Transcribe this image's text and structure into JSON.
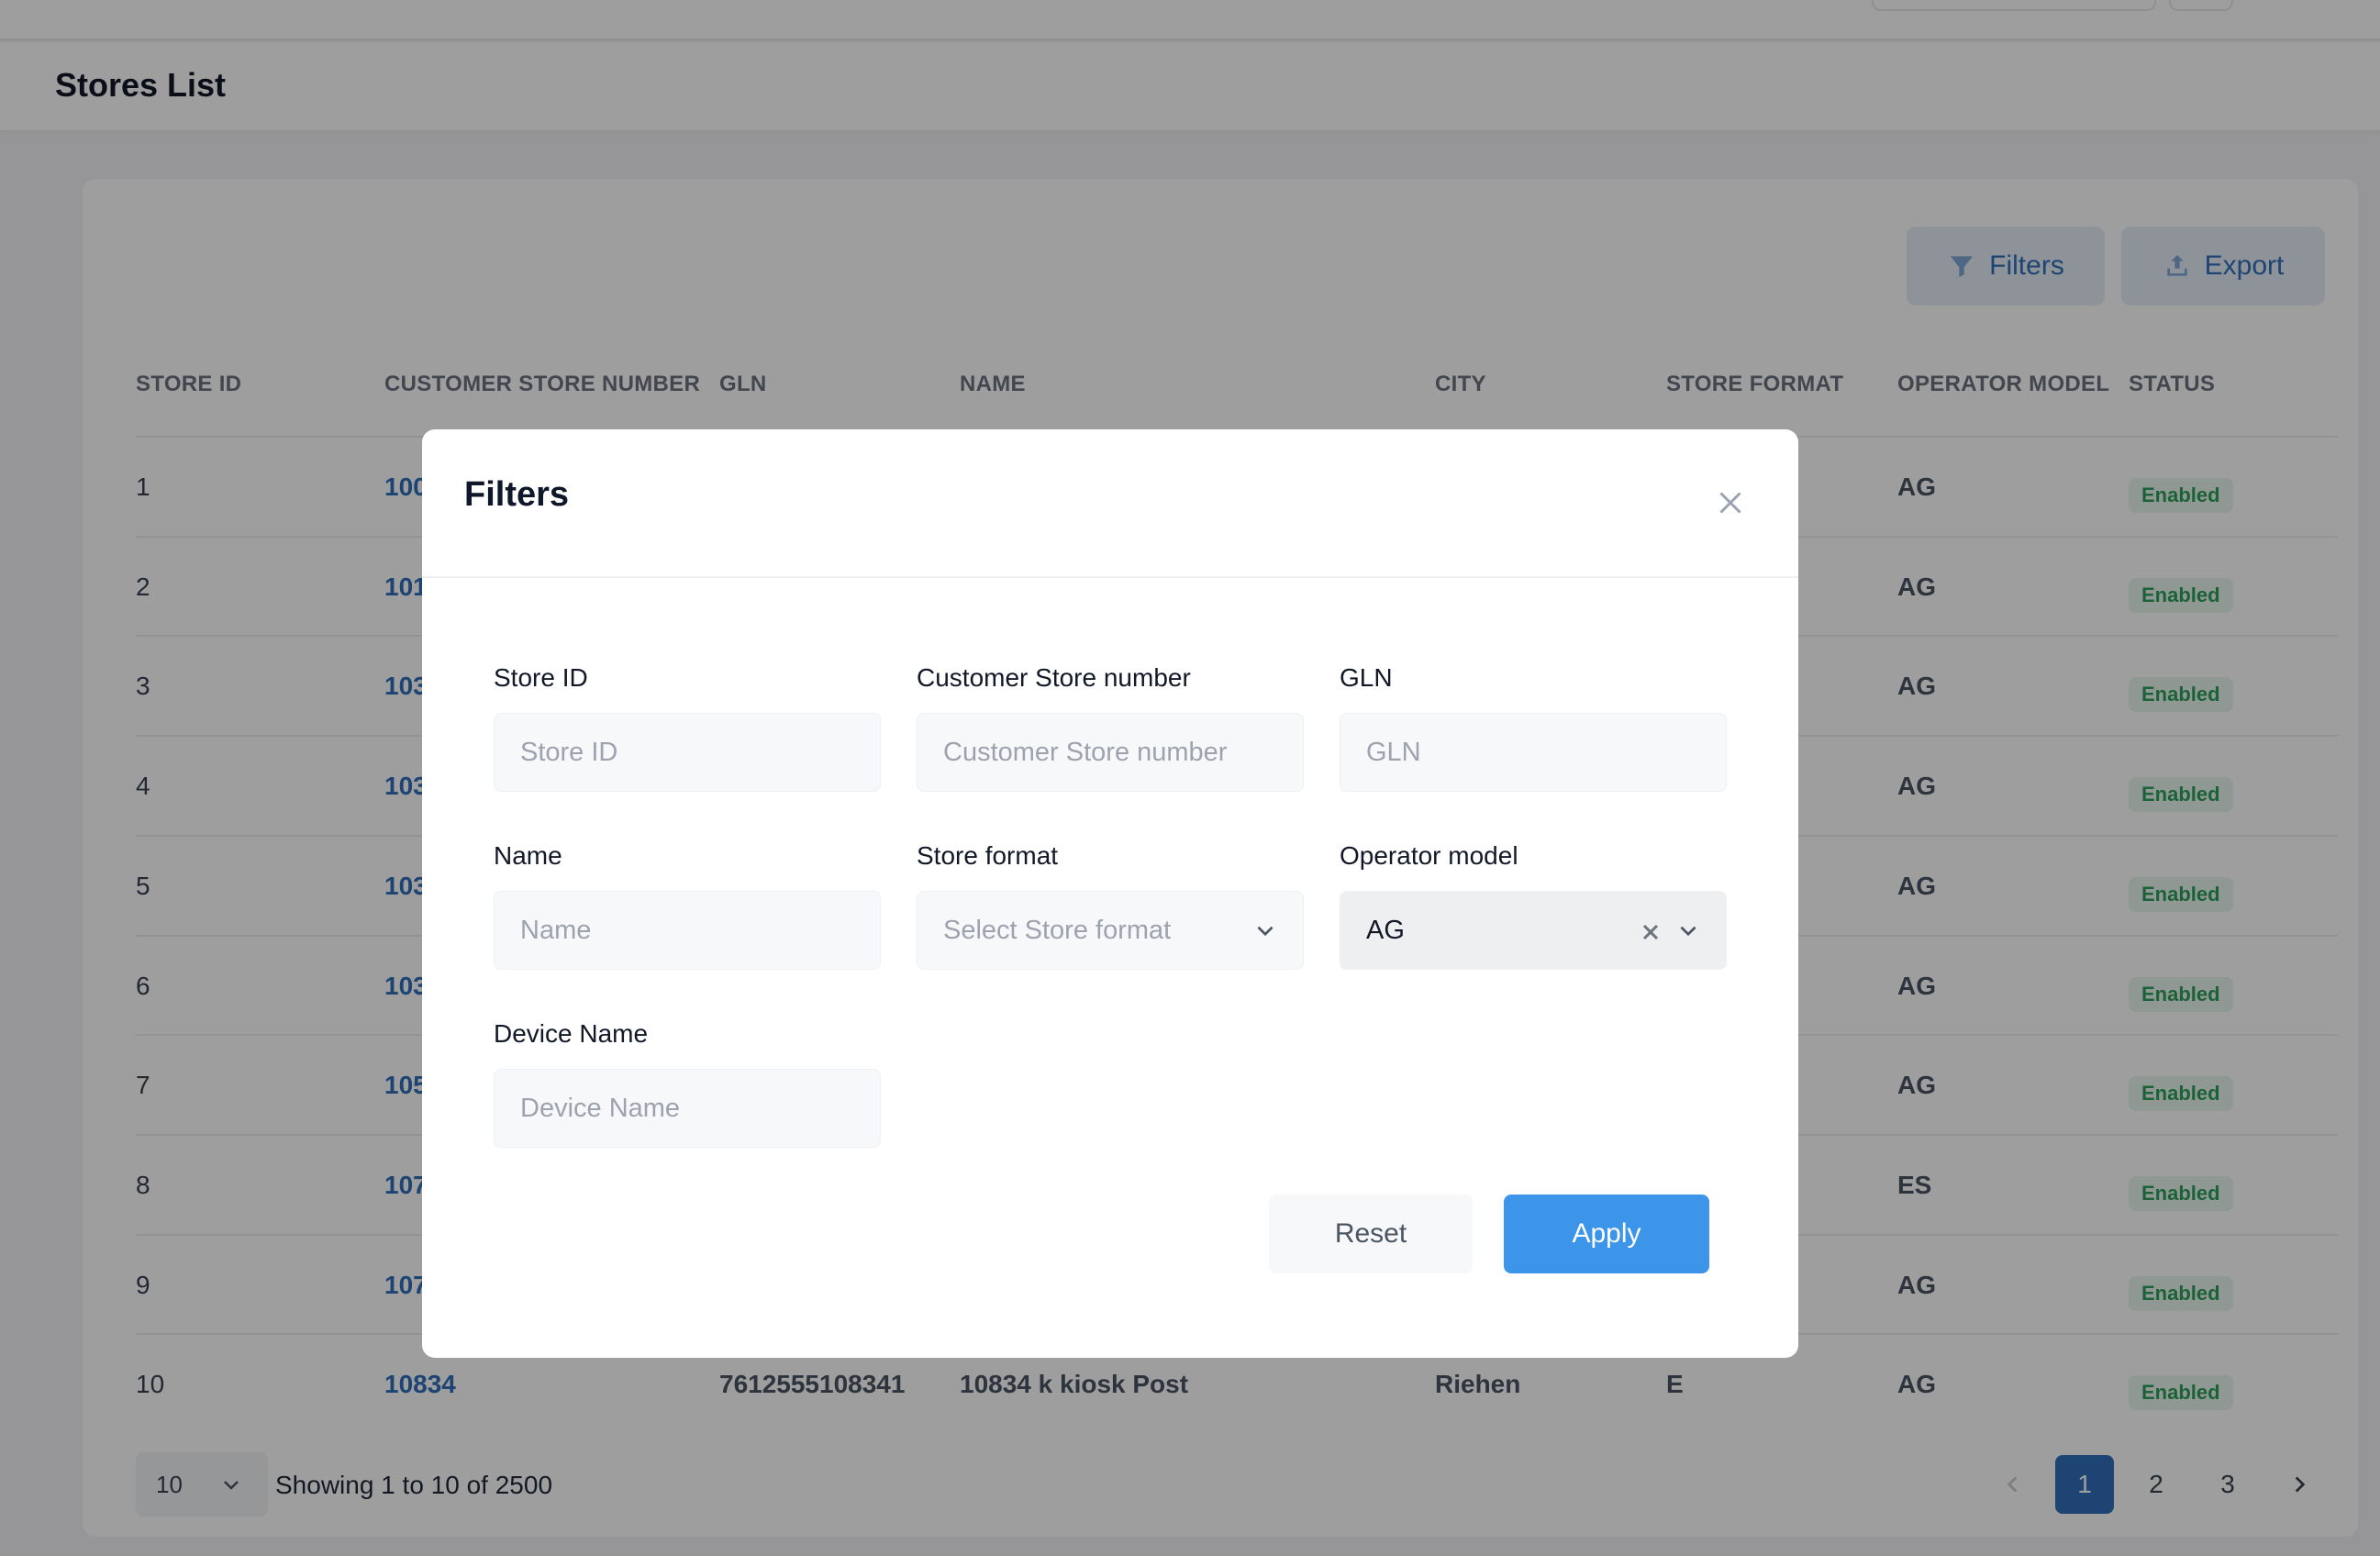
{
  "page": {
    "title": "Stores List"
  },
  "toolbar": {
    "filters_label": "Filters",
    "export_label": "Export"
  },
  "table": {
    "headers": [
      "STORE ID",
      "CUSTOMER STORE NUMBER",
      "GLN",
      "NAME",
      "CITY",
      "STORE FORMAT",
      "OPERATOR MODEL",
      "STATUS"
    ],
    "rows": [
      {
        "store_id": "1",
        "customer_store_number": "100",
        "operator_model": "AG",
        "status": "Enabled"
      },
      {
        "store_id": "2",
        "customer_store_number": "101",
        "operator_model": "AG",
        "status": "Enabled"
      },
      {
        "store_id": "3",
        "customer_store_number": "103",
        "operator_model": "AG",
        "status": "Enabled"
      },
      {
        "store_id": "4",
        "customer_store_number": "103",
        "operator_model": "AG",
        "status": "Enabled"
      },
      {
        "store_id": "5",
        "customer_store_number": "103",
        "operator_model": "AG",
        "status": "Enabled"
      },
      {
        "store_id": "6",
        "customer_store_number": "103",
        "operator_model": "AG",
        "status": "Enabled"
      },
      {
        "store_id": "7",
        "customer_store_number": "105",
        "operator_model": "AG",
        "status": "Enabled"
      },
      {
        "store_id": "8",
        "customer_store_number": "107",
        "operator_model": "ES",
        "status": "Enabled"
      },
      {
        "store_id": "9",
        "customer_store_number": "107",
        "operator_model": "AG",
        "status": "Enabled"
      },
      {
        "store_id": "10",
        "customer_store_number": "10834",
        "gln": "7612555108341",
        "name": "10834 k kiosk Post",
        "city": "Riehen",
        "store_format": "E",
        "operator_model": "AG",
        "status": "Enabled"
      }
    ]
  },
  "footer": {
    "page_size": "10",
    "showing": "Showing 1 to 10 of 2500",
    "pages": [
      "1",
      "2",
      "3"
    ],
    "current_page": "1"
  },
  "modal": {
    "title": "Filters",
    "fields": {
      "store_id": {
        "label": "Store ID",
        "placeholder": "Store ID"
      },
      "customer_store_number": {
        "label": "Customer Store number",
        "placeholder": "Customer Store number"
      },
      "gln": {
        "label": "GLN",
        "placeholder": "GLN"
      },
      "name": {
        "label": "Name",
        "placeholder": "Name"
      },
      "store_format": {
        "label": "Store format",
        "placeholder": "Select Store format"
      },
      "operator_model": {
        "label": "Operator model",
        "value": "AG"
      },
      "device_name": {
        "label": "Device Name",
        "placeholder": "Device Name"
      }
    },
    "reset_label": "Reset",
    "apply_label": "Apply"
  },
  "colors": {
    "accent": "#2f6fb8",
    "apply": "#3d95ea",
    "enabled_text": "#2e9e5b",
    "enabled_bg": "#e7f6ec"
  },
  "icons": [
    "filter-icon",
    "export-icon",
    "close-icon",
    "chevron-down-icon",
    "clear-icon",
    "chevron-left-icon",
    "chevron-right-icon"
  ]
}
